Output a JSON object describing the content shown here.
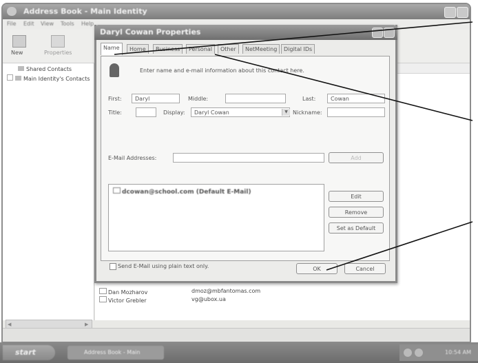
{
  "window": {
    "title": "Address Book - Main Identity",
    "menu": [
      "File",
      "Edit",
      "View",
      "Tools",
      "Help"
    ],
    "toolbar": [
      "New",
      "Properties"
    ]
  },
  "tree": {
    "items": [
      "Shared Contacts",
      "Main Identity's Contacts"
    ]
  },
  "contacts": [
    {
      "name": "Dan Mozharov",
      "email": "dmoz@mbfantomas.com"
    },
    {
      "name": "Victor Grebler",
      "email": "vg@ubox.ua"
    }
  ],
  "dialog": {
    "title": "Daryl Cowan Properties",
    "tabs": [
      "Name",
      "Home",
      "Business",
      "Personal",
      "Other",
      "NetMeeting",
      "Digital IDs"
    ],
    "intro": "Enter name and e-mail information about this contact here.",
    "labels": {
      "first": "First:",
      "middle": "Middle:",
      "last": "Last:",
      "title": "Title:",
      "display": "Display:",
      "nickname": "Nickname:",
      "email_addresses": "E-Mail Addresses:"
    },
    "values": {
      "first": "Daryl",
      "middle": "",
      "last": "Cowan",
      "title": "",
      "display": "Daryl Cowan",
      "nickname": "",
      "email_input": ""
    },
    "email_entry": "dcowan@school.com (Default E-Mail)",
    "buttons": {
      "add": "Add",
      "edit": "Edit",
      "remove": "Remove",
      "set_default": "Set as Default",
      "ok": "OK",
      "cancel": "Cancel"
    },
    "plain_text_label": "Send E-Mail using plain text only."
  },
  "taskbar": {
    "start": "start",
    "task": "Address Book - Main",
    "tray_time": "10:54 AM"
  }
}
